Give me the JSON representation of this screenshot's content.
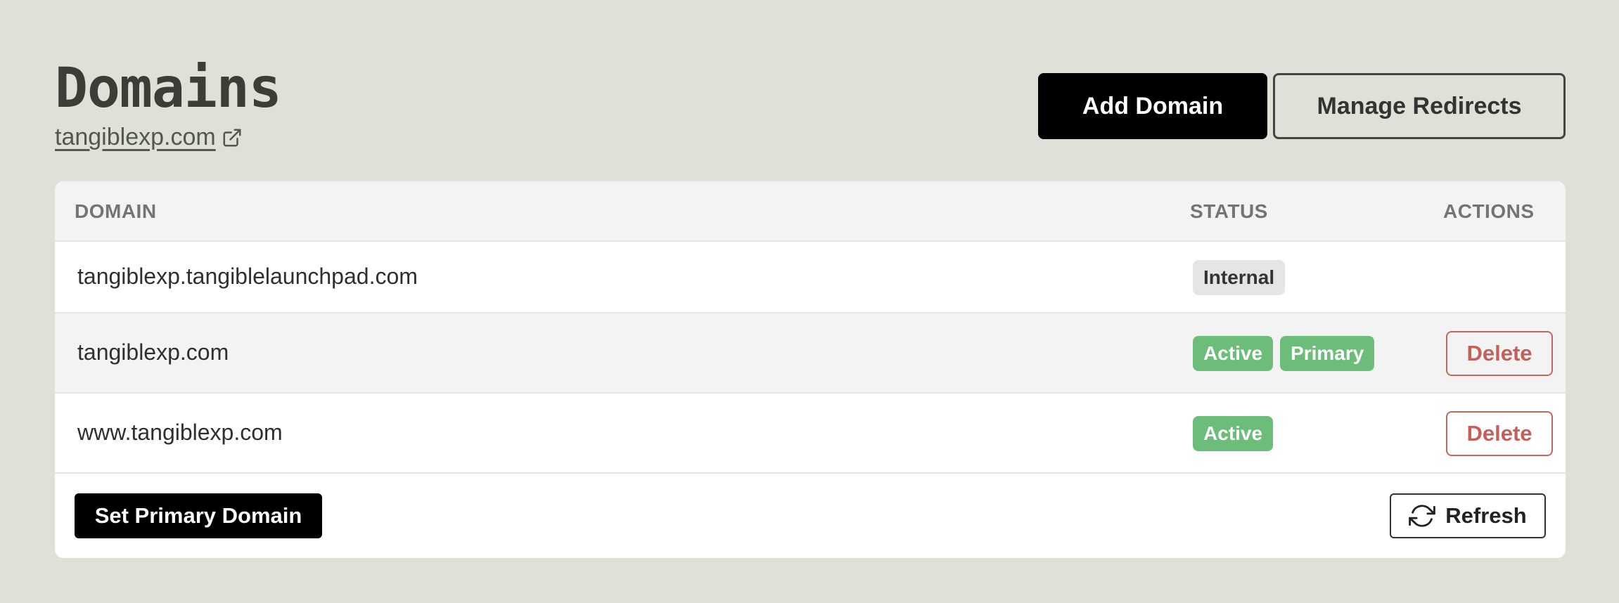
{
  "header": {
    "title": "Domains",
    "site_link": "tangiblexp.com",
    "external_link_icon": "external-link-icon",
    "add_domain_label": "Add Domain",
    "manage_redirects_label": "Manage Redirects"
  },
  "table": {
    "columns": {
      "domain": "DOMAIN",
      "status": "STATUS",
      "actions": "ACTIONS"
    },
    "rows": [
      {
        "domain": "tangiblexp.tangiblelaunchpad.com",
        "badges": [
          "Internal"
        ],
        "action": ""
      },
      {
        "domain": "tangiblexp.com",
        "badges": [
          "Active",
          "Primary"
        ],
        "action": "Delete"
      },
      {
        "domain": "www.tangiblexp.com",
        "badges": [
          "Active"
        ],
        "action": "Delete"
      }
    ]
  },
  "footer": {
    "set_primary_label": "Set Primary Domain",
    "refresh_label": "Refresh",
    "refresh_icon": "refresh-icon"
  },
  "colors": {
    "background": "#dfe0d7",
    "primary_button": "#000000",
    "badge_active": "#6cbc7a",
    "badge_internal": "#e5e5e5",
    "delete": "#c65e5a"
  }
}
